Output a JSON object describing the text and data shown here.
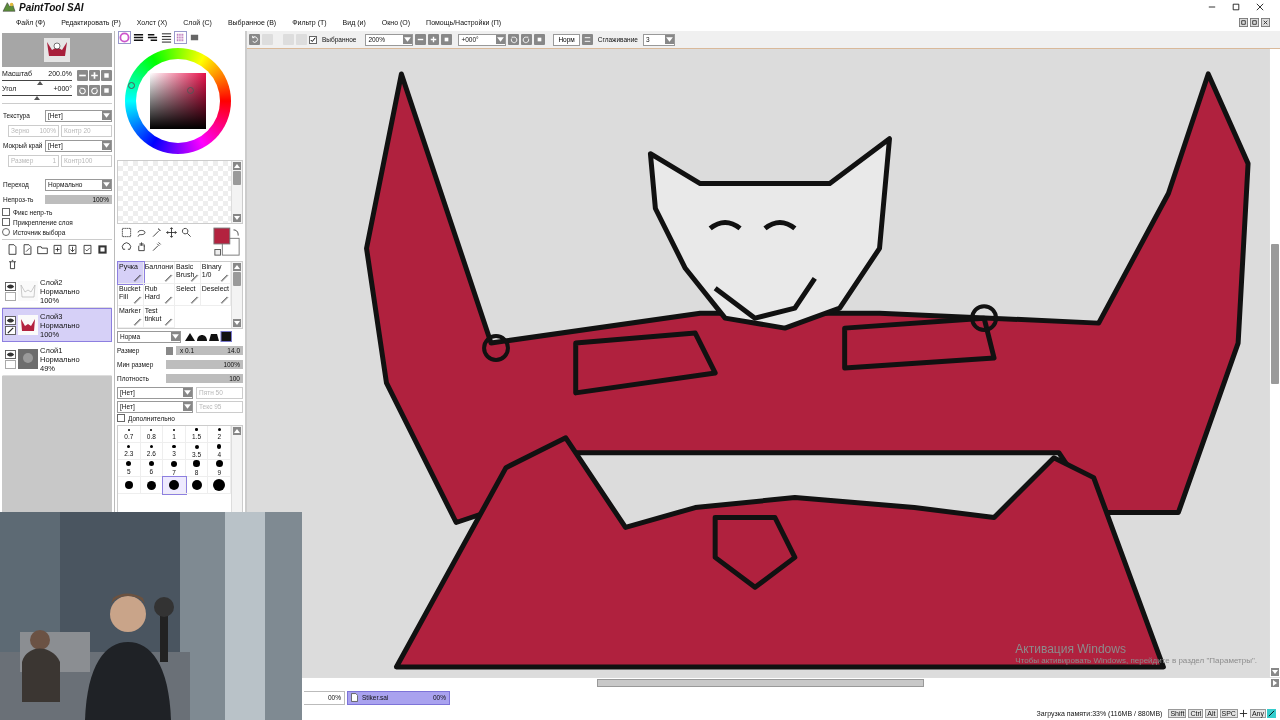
{
  "app": {
    "title": "PaintTool SAI"
  },
  "menu": [
    "Файл (Ф)",
    "Редактировать (Р)",
    "Холст (Х)",
    "Слой (С)",
    "Выбранное (В)",
    "Фильтр (Т)",
    "Вид (и)",
    "Окно (О)",
    "Помощь/Настройки (П)"
  ],
  "toolbar": {
    "selection_label": "Выбранное",
    "selection_checked": true,
    "zoom": "200%",
    "angle": "+000°",
    "mode_button": "Норм",
    "smoothing_label": "Сглаживание",
    "smoothing": "3"
  },
  "navigator": {
    "zoom": {
      "label": "Масштаб",
      "value": "200.0%",
      "level": 0.55
    },
    "angle": {
      "label": "Угол",
      "value": "+000°",
      "level": 0.5
    }
  },
  "texture": [
    {
      "kind": "select",
      "label": "Текстура",
      "value": "[Нет]"
    },
    {
      "kind": "pair",
      "disabled": true,
      "a_label": "Зерно",
      "a_value": "100%",
      "b_label": "Контр 20"
    },
    {
      "kind": "select",
      "label": "Мокрый край",
      "value": "[Нет]"
    },
    {
      "kind": "pair",
      "disabled": true,
      "a_label": "Размер",
      "a_value": "1",
      "b_label": "Контр100"
    }
  ],
  "blend": {
    "label": "Переход",
    "value": "Нормально"
  },
  "opacity": {
    "label": "Непроз-ть",
    "value": "100%",
    "level": 1
  },
  "options": [
    {
      "kind": "checkbox",
      "label": "Фикс непр-ть",
      "checked": false
    },
    {
      "kind": "checkbox",
      "label": "Прикрепление слоя",
      "checked": false
    },
    {
      "kind": "radio",
      "label": "Источник выбора",
      "checked": false
    }
  ],
  "layers": [
    {
      "name": "Слой2",
      "mode": "Нормально",
      "opacity": "100%",
      "visible": true,
      "selected": false
    },
    {
      "name": "Слой3",
      "mode": "Нормально",
      "opacity": "100%",
      "visible": true,
      "selected": true
    },
    {
      "name": "Слой1",
      "mode": "Нормально",
      "opacity": "49%",
      "visible": true,
      "selected": false
    }
  ],
  "brushes": [
    {
      "label": "Ручка",
      "selected": true
    },
    {
      "label": "Баллони",
      "selected": false
    },
    {
      "label": "Basic\nBrush",
      "selected": false
    },
    {
      "label": "Binary\n1/0",
      "selected": false
    },
    {
      "label": "Bucket\nFill",
      "selected": false
    },
    {
      "label": "Rub\nHard",
      "selected": false
    },
    {
      "label": "Select",
      "selected": false
    },
    {
      "label": "Deselect",
      "selected": false
    },
    {
      "label": "Marker",
      "selected": false
    },
    {
      "label": "Test\ntinkut",
      "selected": false
    }
  ],
  "brush_settings": {
    "shape": "Норма",
    "size": {
      "label": "Размер",
      "multiplier": "x 0.1",
      "value": "14.0",
      "level": 1
    },
    "min_size": {
      "label": "Мин размер",
      "value": "100%",
      "level": 1
    },
    "density": {
      "label": "Плотность",
      "value": "100",
      "level": 1
    }
  },
  "brush_textures": [
    {
      "value": "[Нет]",
      "param": "Пятн 50",
      "disabled": true
    },
    {
      "value": "[Нет]",
      "param": "Текс 95",
      "disabled": true
    }
  ],
  "advanced": {
    "label": "Дополнительно",
    "checked": false
  },
  "sizes": [
    {
      "label": "0.7",
      "selected": false
    },
    {
      "label": "0.8",
      "selected": false
    },
    {
      "label": "1",
      "selected": false
    },
    {
      "label": "1.5",
      "selected": false
    },
    {
      "label": "2",
      "selected": false
    },
    {
      "label": "2.3",
      "selected": false
    },
    {
      "label": "2.6",
      "selected": false
    },
    {
      "label": "3",
      "selected": false
    },
    {
      "label": "3.5",
      "selected": false
    },
    {
      "label": "4",
      "selected": false
    },
    {
      "label": "5",
      "selected": false
    },
    {
      "label": "6",
      "selected": false
    },
    {
      "label": "7",
      "selected": false
    },
    {
      "label": "8",
      "selected": false
    },
    {
      "label": "9",
      "selected": false
    },
    {
      "selected": false
    },
    {
      "selected": false
    },
    {
      "selected": true
    },
    {
      "selected": false
    },
    {
      "selected": false
    }
  ],
  "activation": {
    "title": "Активация Windows",
    "text": "Чтобы активировать Windows, перейдите в раздел \"Параметры\"."
  },
  "documents": [
    {
      "progress": "00%",
      "selected": false
    },
    {
      "name": "Stiker.sai",
      "progress": "00%",
      "selected": true
    }
  ],
  "status": {
    "memory": "Загрузка памяти:33% (116MB / 880MB)",
    "keys": [
      "Shift",
      "Ctrl",
      "Alt",
      "SPC"
    ],
    "any": "Any"
  }
}
